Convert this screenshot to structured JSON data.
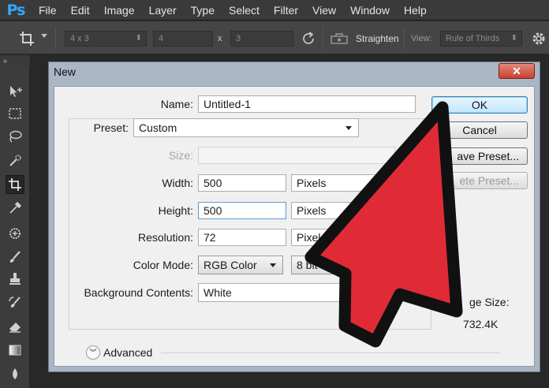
{
  "app": {
    "logo": "Ps"
  },
  "menu": [
    "File",
    "Edit",
    "Image",
    "Layer",
    "Type",
    "Select",
    "Filter",
    "View",
    "Window",
    "Help"
  ],
  "options_bar": {
    "ratio_preset": "4 x 3",
    "width_value": "4",
    "times_sign": "x",
    "height_value": "3",
    "straighten_label": "Straighten",
    "view_label": "View:",
    "view_value": "Rule of Thirds",
    "icons": {
      "crop": "crop-icon",
      "rotate": "rotate-icon",
      "straighten": "level-icon",
      "settings": "gear-icon"
    }
  },
  "panel_strip": {
    "label": "»"
  },
  "toolbar": {
    "tools": [
      "move-icon",
      "marquee-icon",
      "lasso-icon",
      "quick-select-icon",
      "crop-icon",
      "eyedropper-icon",
      "healing-brush-icon",
      "brush-icon",
      "clone-stamp-icon",
      "history-brush-icon",
      "eraser-icon",
      "gradient-icon",
      "blur-icon"
    ],
    "active_index": 4
  },
  "dialog": {
    "title": "New",
    "close_symbol": "✕",
    "name_label": "Name:",
    "name_value": "Untitled-1",
    "preset_label": "Preset:",
    "preset_value": "Custom",
    "size_label": "Size:",
    "width_label": "Width:",
    "width_value": "500",
    "width_unit": "Pixels",
    "height_label": "Height:",
    "height_value": "500",
    "height_unit": "Pixels",
    "resolution_label": "Resolution:",
    "resolution_value": "72",
    "resolution_unit": "Pixel",
    "color_mode_label": "Color Mode:",
    "color_mode_value": "RGB Color",
    "bit_depth_value": "8 bit",
    "background_label": "Background Contents:",
    "background_value": "White",
    "advanced_label": "Advanced",
    "advanced_icon": "chevron-double-down-icon",
    "buttons": {
      "ok": "OK",
      "cancel": "Cancel",
      "save_preset": "ave Preset...",
      "delete_preset": "ete Preset..."
    },
    "image_size_label": "ge Size:",
    "image_size_value": "732.4K"
  },
  "colors": {
    "arrow_red": "#e02b37",
    "arrow_outline": "#111111",
    "ps_blue": "#31a8ff"
  }
}
